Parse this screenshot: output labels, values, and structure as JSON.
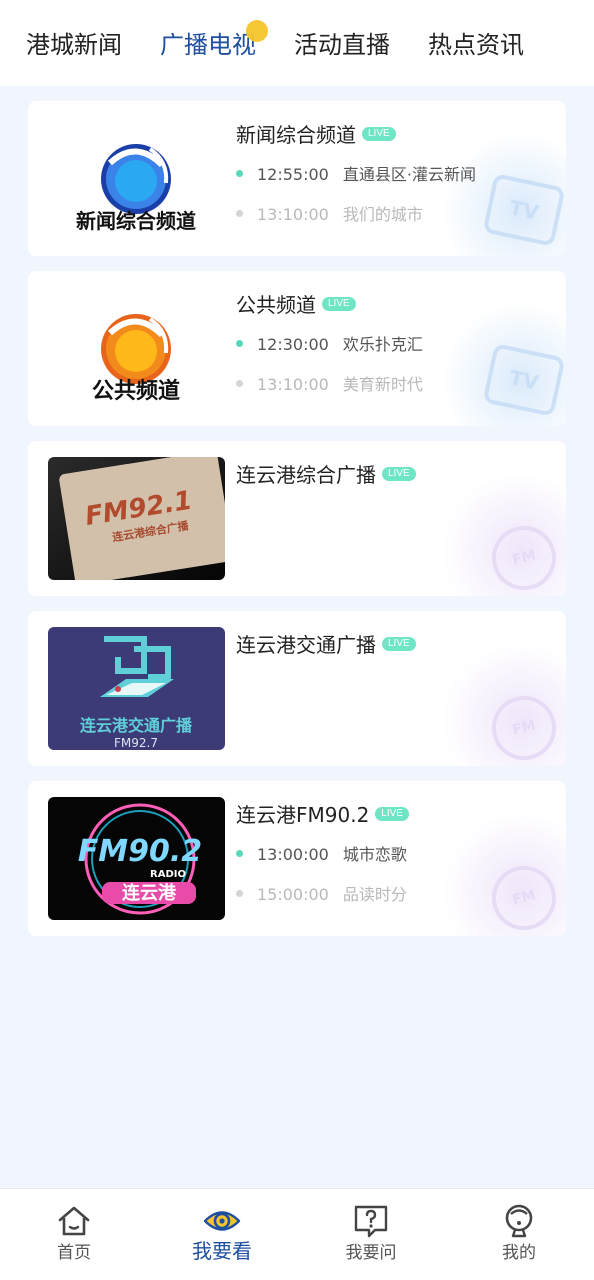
{
  "top_tabs": [
    {
      "label": "港城新闻",
      "active": false
    },
    {
      "label": "广播电视",
      "active": true
    },
    {
      "label": "活动直播",
      "active": false
    },
    {
      "label": "热点资讯",
      "active": false
    }
  ],
  "live_badge": "LIVE",
  "channels": [
    {
      "title": "新闻综合频道",
      "logo_text": "新闻综合频道",
      "kind": "tv",
      "watermark": "TV",
      "programs": [
        {
          "time": "12:55:00",
          "name": "直通县区·灌云新闻",
          "state": "now"
        },
        {
          "time": "13:10:00",
          "name": "我们的城市",
          "state": "next"
        }
      ]
    },
    {
      "title": "公共频道",
      "logo_text": "公共频道",
      "kind": "tv",
      "watermark": "TV",
      "programs": [
        {
          "time": "12:30:00",
          "name": "欢乐扑克汇",
          "state": "now"
        },
        {
          "time": "13:10:00",
          "name": "美育新时代",
          "state": "next"
        }
      ]
    },
    {
      "title": "连云港综合广播",
      "logo_text": "连云港综合广播",
      "kind": "fm",
      "watermark": "FM",
      "programs": []
    },
    {
      "title": "连云港交通广播",
      "logo_text_main": "连云港交通广播",
      "logo_text_sub": "FM92.7",
      "kind": "fm",
      "watermark": "FM",
      "programs": []
    },
    {
      "title": "连云港FM90.2",
      "logo_text_main": "FM90.2",
      "logo_text_radio": "RADIO",
      "logo_text_city": "连云港",
      "kind": "fm",
      "watermark": "FM",
      "programs": [
        {
          "time": "13:00:00",
          "name": "城市恋歌",
          "state": "now"
        },
        {
          "time": "15:00:00",
          "name": "品读时分",
          "state": "next"
        }
      ]
    }
  ],
  "bottom_nav": [
    {
      "label": "首页",
      "icon": "home-icon",
      "active": false
    },
    {
      "label": "我要看",
      "icon": "eye-icon",
      "active": true
    },
    {
      "label": "我要问",
      "icon": "question-bubble-icon",
      "active": false
    },
    {
      "label": "我的",
      "icon": "profile-icon",
      "active": false
    }
  ],
  "colors": {
    "accent": "#1f4fa0",
    "live": "#6ee6c6",
    "now_dot": "#5ad6b8",
    "background": "#f1f5fd",
    "tab_dot": "#f7c52b"
  }
}
